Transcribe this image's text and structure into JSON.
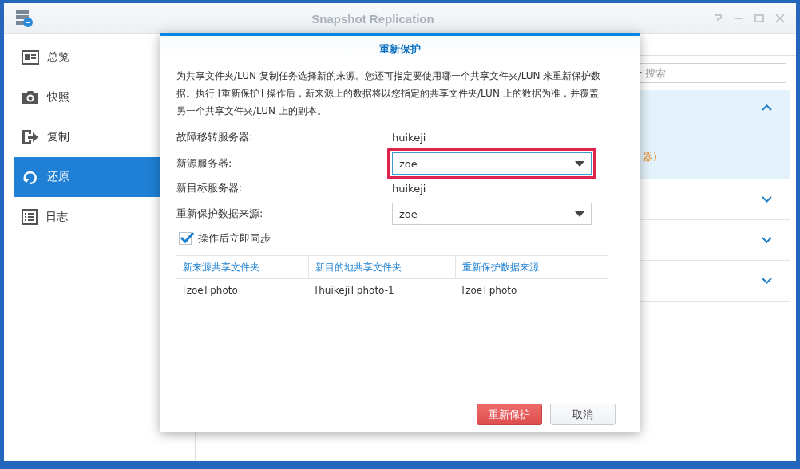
{
  "window": {
    "title": "Snapshot Replication"
  },
  "sidebar": {
    "items": [
      {
        "label": "总览",
        "selected": false
      },
      {
        "label": "快照",
        "selected": false
      },
      {
        "label": "复制",
        "selected": false
      },
      {
        "label": "还原",
        "selected": true
      },
      {
        "label": "日志",
        "selected": false
      }
    ]
  },
  "main": {
    "search": {
      "placeholder": "搜索"
    },
    "panels": [
      {
        "expanded": true,
        "note": "器)"
      },
      {
        "expanded": false
      },
      {
        "expanded": false
      },
      {
        "expanded": false
      }
    ]
  },
  "dialog": {
    "title": "重新保护",
    "description": "为共享文件夹/LUN 复制任务选择新的来源。您还可指定要使用哪一个共享文件夹/LUN 来重新保护数据。执行 [重新保护] 操作后，新来源上的数据将以您指定的共享文件夹/LUN 上的数据为准，并覆盖另一个共享文件夹/LUN 上的副本。",
    "fields": [
      {
        "label": "故障移转服务器:",
        "kind": "text",
        "value": "huikeji",
        "highlighted": false
      },
      {
        "label": "新源服务器:",
        "kind": "select",
        "value": "zoe",
        "highlighted": true
      },
      {
        "label": "新目标服务器:",
        "kind": "text",
        "value": "huikeji",
        "highlighted": false
      },
      {
        "label": "重新保护数据来源:",
        "kind": "select",
        "value": "zoe",
        "highlighted": false
      }
    ],
    "checkbox": {
      "label": "操作后立即同步",
      "checked": true
    },
    "table": {
      "columns": [
        "新来源共享文件夹",
        "新目的地共享文件夹",
        "重新保护数据来源"
      ],
      "rows": [
        [
          "[zoe] photo",
          "[huikeji] photo-1",
          "[zoe] photo"
        ]
      ]
    },
    "buttons": [
      {
        "label": "重新保护",
        "kind": "primary"
      },
      {
        "label": "取消",
        "kind": "default"
      }
    ]
  }
}
